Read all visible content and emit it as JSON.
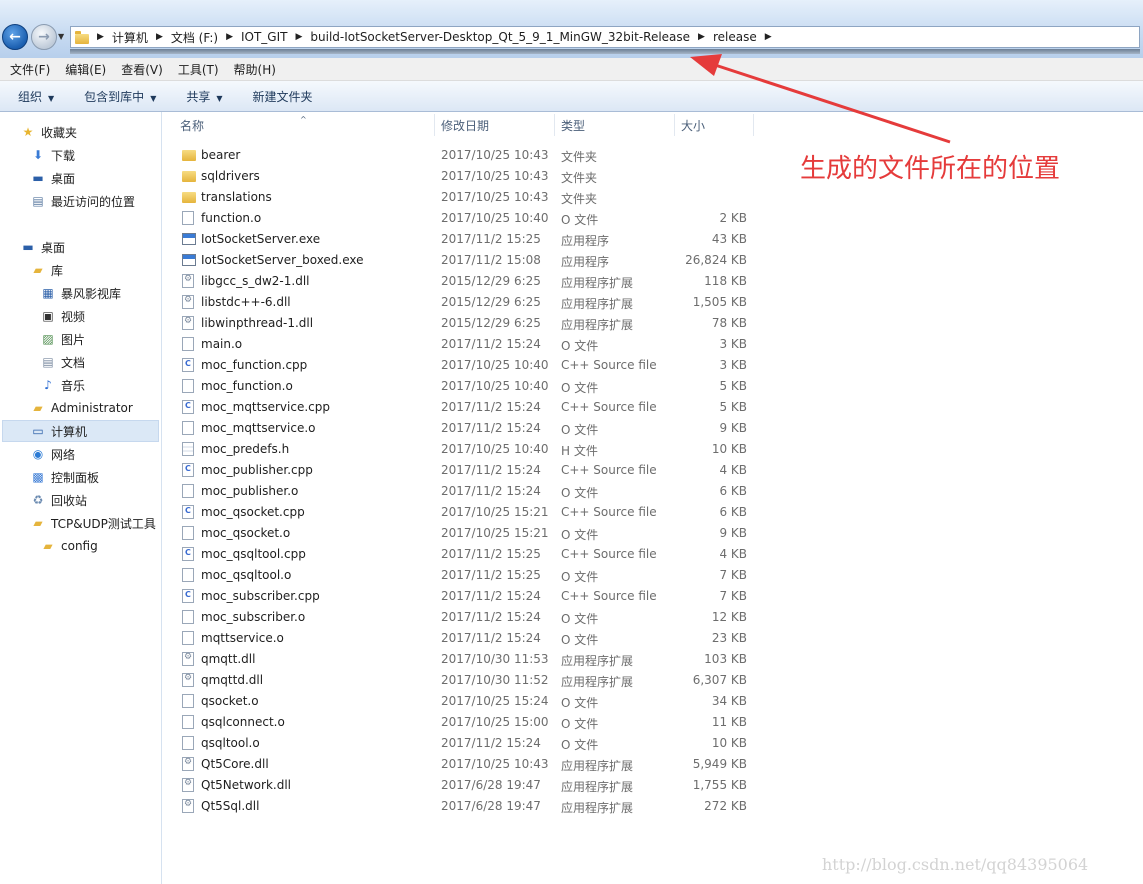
{
  "address": {
    "crumbs": [
      "计算机",
      "文档 (F:)",
      "IOT_GIT",
      "build-IotSocketServer-Desktop_Qt_5_9_1_MinGW_32bit-Release",
      "release"
    ]
  },
  "menu": [
    "文件(F)",
    "编辑(E)",
    "查看(V)",
    "工具(T)",
    "帮助(H)"
  ],
  "toolbar": {
    "organize": "组织",
    "include_library": "包含到库中",
    "share": "共享",
    "new_folder": "新建文件夹"
  },
  "sidebar": {
    "favorites": "收藏夹",
    "downloads": "下载",
    "desktop_fav": "桌面",
    "recent": "最近访问的位置",
    "desktop": "桌面",
    "library": "库",
    "storm": "暴风影视库",
    "video": "视频",
    "pictures": "图片",
    "documents": "文档",
    "music": "音乐",
    "admin": "Administrator",
    "computer": "计算机",
    "network": "网络",
    "control_panel": "控制面板",
    "recycle": "回收站",
    "tcp_tool": "TCP&UDP测试工具",
    "config": "config"
  },
  "columns": {
    "name": "名称",
    "date": "修改日期",
    "type": "类型",
    "size": "大小"
  },
  "files": [
    {
      "name": "bearer",
      "date": "2017/10/25 10:43",
      "type": "文件夹",
      "size": "",
      "icon": "folder-icon"
    },
    {
      "name": "sqldrivers",
      "date": "2017/10/25 10:43",
      "type": "文件夹",
      "size": "",
      "icon": "folder-icon"
    },
    {
      "name": "translations",
      "date": "2017/10/25 10:43",
      "type": "文件夹",
      "size": "",
      "icon": "folder-icon"
    },
    {
      "name": "function.o",
      "date": "2017/10/25 10:40",
      "type": "O 文件",
      "size": "2 KB",
      "icon": "file-icon"
    },
    {
      "name": "IotSocketServer.exe",
      "date": "2017/11/2 15:25",
      "type": "应用程序",
      "size": "43 KB",
      "icon": "exe-icon"
    },
    {
      "name": "IotSocketServer_boxed.exe",
      "date": "2017/11/2 15:08",
      "type": "应用程序",
      "size": "26,824 KB",
      "icon": "exe-icon"
    },
    {
      "name": "libgcc_s_dw2-1.dll",
      "date": "2015/12/29 6:25",
      "type": "应用程序扩展",
      "size": "118 KB",
      "icon": "dll-icon"
    },
    {
      "name": "libstdc++-6.dll",
      "date": "2015/12/29 6:25",
      "type": "应用程序扩展",
      "size": "1,505 KB",
      "icon": "dll-icon"
    },
    {
      "name": "libwinpthread-1.dll",
      "date": "2015/12/29 6:25",
      "type": "应用程序扩展",
      "size": "78 KB",
      "icon": "dll-icon"
    },
    {
      "name": "main.o",
      "date": "2017/11/2 15:24",
      "type": "O 文件",
      "size": "3 KB",
      "icon": "file-icon"
    },
    {
      "name": "moc_function.cpp",
      "date": "2017/10/25 10:40",
      "type": "C++ Source file",
      "size": "3 KB",
      "icon": "cpp-icon"
    },
    {
      "name": "moc_function.o",
      "date": "2017/10/25 10:40",
      "type": "O 文件",
      "size": "5 KB",
      "icon": "file-icon"
    },
    {
      "name": "moc_mqttservice.cpp",
      "date": "2017/11/2 15:24",
      "type": "C++ Source file",
      "size": "5 KB",
      "icon": "cpp-icon"
    },
    {
      "name": "moc_mqttservice.o",
      "date": "2017/11/2 15:24",
      "type": "O 文件",
      "size": "9 KB",
      "icon": "file-icon"
    },
    {
      "name": "moc_predefs.h",
      "date": "2017/10/25 10:40",
      "type": "H 文件",
      "size": "10 KB",
      "icon": "header-icon"
    },
    {
      "name": "moc_publisher.cpp",
      "date": "2017/11/2 15:24",
      "type": "C++ Source file",
      "size": "4 KB",
      "icon": "cpp-icon"
    },
    {
      "name": "moc_publisher.o",
      "date": "2017/11/2 15:24",
      "type": "O 文件",
      "size": "6 KB",
      "icon": "file-icon"
    },
    {
      "name": "moc_qsocket.cpp",
      "date": "2017/10/25 15:21",
      "type": "C++ Source file",
      "size": "6 KB",
      "icon": "cpp-icon"
    },
    {
      "name": "moc_qsocket.o",
      "date": "2017/10/25 15:21",
      "type": "O 文件",
      "size": "9 KB",
      "icon": "file-icon"
    },
    {
      "name": "moc_qsqltool.cpp",
      "date": "2017/11/2 15:25",
      "type": "C++ Source file",
      "size": "4 KB",
      "icon": "cpp-icon"
    },
    {
      "name": "moc_qsqltool.o",
      "date": "2017/11/2 15:25",
      "type": "O 文件",
      "size": "7 KB",
      "icon": "file-icon"
    },
    {
      "name": "moc_subscriber.cpp",
      "date": "2017/11/2 15:24",
      "type": "C++ Source file",
      "size": "7 KB",
      "icon": "cpp-icon"
    },
    {
      "name": "moc_subscriber.o",
      "date": "2017/11/2 15:24",
      "type": "O 文件",
      "size": "12 KB",
      "icon": "file-icon"
    },
    {
      "name": "mqttservice.o",
      "date": "2017/11/2 15:24",
      "type": "O 文件",
      "size": "23 KB",
      "icon": "file-icon"
    },
    {
      "name": "qmqtt.dll",
      "date": "2017/10/30 11:53",
      "type": "应用程序扩展",
      "size": "103 KB",
      "icon": "dll-icon"
    },
    {
      "name": "qmqttd.dll",
      "date": "2017/10/30 11:52",
      "type": "应用程序扩展",
      "size": "6,307 KB",
      "icon": "dll-icon"
    },
    {
      "name": "qsocket.o",
      "date": "2017/10/25 15:24",
      "type": "O 文件",
      "size": "34 KB",
      "icon": "file-icon"
    },
    {
      "name": "qsqlconnect.o",
      "date": "2017/10/25 15:00",
      "type": "O 文件",
      "size": "11 KB",
      "icon": "file-icon"
    },
    {
      "name": "qsqltool.o",
      "date": "2017/11/2 15:24",
      "type": "O 文件",
      "size": "10 KB",
      "icon": "file-icon"
    },
    {
      "name": "Qt5Core.dll",
      "date": "2017/10/25 10:43",
      "type": "应用程序扩展",
      "size": "5,949 KB",
      "icon": "dll-icon"
    },
    {
      "name": "Qt5Network.dll",
      "date": "2017/6/28 19:47",
      "type": "应用程序扩展",
      "size": "1,755 KB",
      "icon": "dll-icon"
    },
    {
      "name": "Qt5Sql.dll",
      "date": "2017/6/28 19:47",
      "type": "应用程序扩展",
      "size": "272 KB",
      "icon": "dll-icon"
    }
  ],
  "annotation": "生成的文件所在的位置",
  "watermark": "http://blog.csdn.net/qq84395064",
  "colors": {
    "annotation": "#e53b3b",
    "selection": "#dbe8f6"
  }
}
